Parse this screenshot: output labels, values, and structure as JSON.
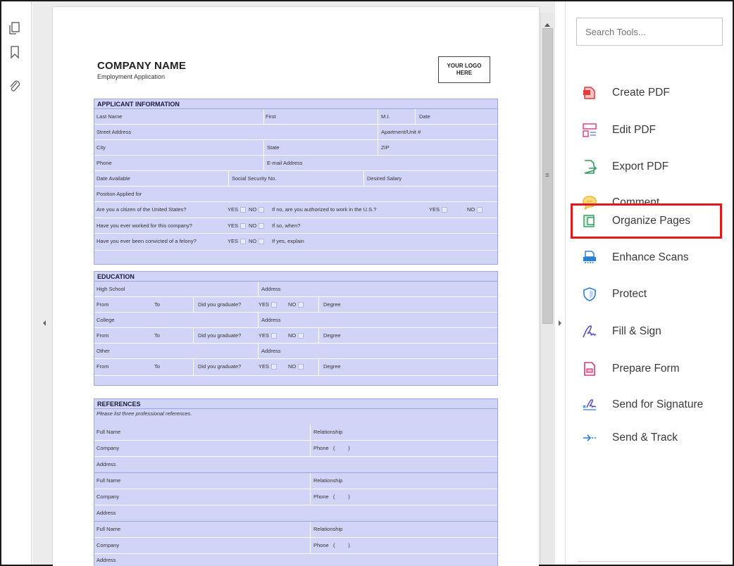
{
  "search": {
    "placeholder": "Search Tools..."
  },
  "tools": [
    {
      "label": "Create PDF",
      "icon": "create-pdf-icon",
      "color": "#e03a3a"
    },
    {
      "label": "Edit PDF",
      "icon": "edit-pdf-icon",
      "color": "#e0448a"
    },
    {
      "label": "Export PDF",
      "icon": "export-pdf-icon",
      "color": "#2e9b5c"
    },
    {
      "label": "Comment",
      "icon": "comment-icon",
      "color": "#f2b01e"
    },
    {
      "label": "Organize Pages",
      "icon": "organize-pages-icon",
      "color": "#2e9b5c"
    },
    {
      "label": "Enhance Scans",
      "icon": "enhance-scans-icon",
      "color": "#2c7fd6"
    },
    {
      "label": "Protect",
      "icon": "protect-icon",
      "color": "#2c7fd6"
    },
    {
      "label": "Fill & Sign",
      "icon": "fill-sign-icon",
      "color": "#5b4bc4"
    },
    {
      "label": "Prepare Form",
      "icon": "prepare-form-icon",
      "color": "#d43a7a"
    },
    {
      "label": "Send for Signature",
      "icon": "send-signature-icon",
      "color": "#5b4bc4"
    },
    {
      "label": "Send & Track",
      "icon": "send-track-icon",
      "color": "#2c7fd6"
    }
  ],
  "highlight_color": "#e0191e",
  "form": {
    "company": "COMPANY NAME",
    "subtitle": "Employment Application",
    "logo_line1": "YOUR LOGO",
    "logo_line2": "HERE",
    "applicant": {
      "title": "APPLICANT INFORMATION",
      "last_name": "Last Name",
      "first": "First",
      "mi": "M.I.",
      "date": "Date",
      "street": "Street Address",
      "apt": "Apartment/Unit #",
      "city": "City",
      "state": "State",
      "zip": "ZIP",
      "phone": "Phone",
      "email": "E-mail Address",
      "date_available": "Date Available",
      "ssn": "Social Security No.",
      "salary": "Desired Salary",
      "position": "Position Applied for",
      "citizen_q": "Are you a citizen of the United States?",
      "yes": "YES",
      "no": "NO",
      "authorized_q": "If no, are you authorized to work in the U.S.?",
      "worked_q": "Have you ever worked for this company?",
      "when_q": "If so, when?",
      "felony_q": "Have you ever been convicted of a felony?",
      "explain": "If yes, explain"
    },
    "education": {
      "title": "EDUCATION",
      "high_school": "High School",
      "address": "Address",
      "from": "From",
      "to": "To",
      "graduate_q": "Did you graduate?",
      "yes": "YES",
      "no": "NO",
      "degree": "Degree",
      "college": "College",
      "other": "Other"
    },
    "references": {
      "title": "REFERENCES",
      "note": "Please list three professional references.",
      "full_name": "Full Name",
      "relationship": "Relationship",
      "company": "Company",
      "phone": "Phone",
      "phone_open": "(",
      "phone_close": ")",
      "address": "Address"
    }
  }
}
